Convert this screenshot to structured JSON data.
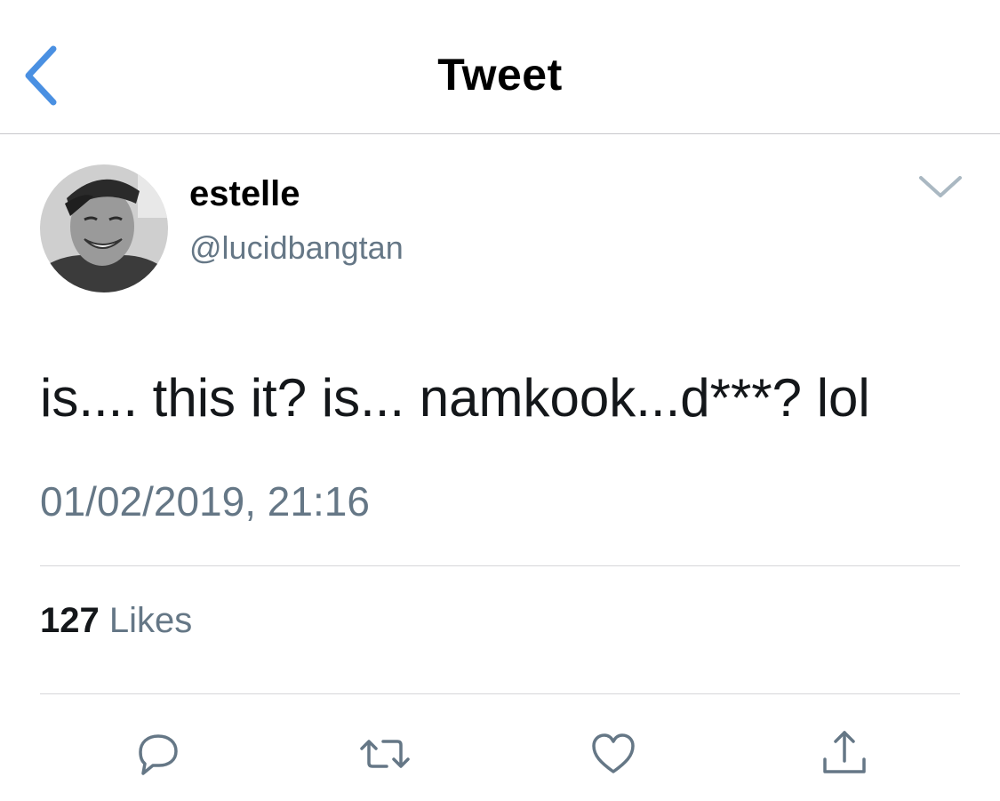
{
  "nav": {
    "title": "Tweet",
    "accent_color": "#4a90e2"
  },
  "tweet": {
    "display_name": "estelle",
    "handle": "@lucidbangtan",
    "text": "is.... this it? is... namkook...d***? lol",
    "timestamp": "01/02/2019, 21:16",
    "likes_count": "127",
    "likes_label": "Likes"
  },
  "icons": {
    "back": "chevron-left-icon",
    "more": "chevron-down-icon",
    "reply": "reply-icon",
    "retweet": "retweet-icon",
    "like": "heart-icon",
    "share": "share-icon"
  }
}
